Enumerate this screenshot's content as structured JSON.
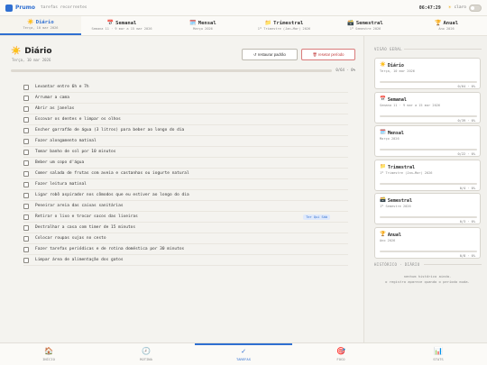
{
  "app": {
    "name": "Prumo",
    "subtitle": "tarefas recorrentes",
    "clock": "06:47:29",
    "theme_label": "claro"
  },
  "tabs": [
    {
      "icon": "☀️",
      "title": "Diário",
      "sub": "Terça, 10 mar 2026",
      "active": true
    },
    {
      "icon": "📅",
      "title": "Semanal",
      "sub": "Semana 11 · 9 mar a 15 mar 2026",
      "active": false
    },
    {
      "icon": "🗓️",
      "title": "Mensal",
      "sub": "Março 2026",
      "active": false
    },
    {
      "icon": "📁",
      "title": "Trimestral",
      "sub": "1º Trimestre (Jan–Mar) 2026",
      "active": false
    },
    {
      "icon": "🗃️",
      "title": "Semestral",
      "sub": "1º Semestre 2026",
      "active": false
    },
    {
      "icon": "🏆",
      "title": "Anual",
      "sub": "Ano 2026",
      "active": false
    }
  ],
  "period": {
    "icon": "☀️",
    "title": "Diário",
    "sub": "Terça, 10 mar 2026",
    "progress": 0,
    "progress_label": "0/64 · 0%"
  },
  "buttons": {
    "restore": "↺ restaurar padrão",
    "reset": "🗑 resetar período"
  },
  "tasks": [
    {
      "label": "Levantar entre 6h e 7h"
    },
    {
      "label": "Arrumar a cama"
    },
    {
      "label": "Abrir as janelas"
    },
    {
      "label": "Escovar os dentes e limpar os olhos"
    },
    {
      "label": "Encher garrafão de água (3 litros) para beber ao longo do dia"
    },
    {
      "label": "Fazer alongamento matinal"
    },
    {
      "label": "Tomar banho de sol por 10 minutos"
    },
    {
      "label": "Beber um copo d'água"
    },
    {
      "label": "Comer salada de frutas com aveia e castanhas ou iogurte natural"
    },
    {
      "label": "Fazer leitura matinal"
    },
    {
      "label": "Ligar robô aspirador nos cômodos que eu estiver ao longo do dia"
    },
    {
      "label": "Peneirar areia das caixas sanitárias"
    },
    {
      "label": "Retirar o lixo e trocar sacos das lixeiras",
      "tag": "Ter Qui Sáb"
    },
    {
      "label": "Destralhar a casa com timer de 15 minutos"
    },
    {
      "label": "Colocar roupas sujas no cesto"
    },
    {
      "label": "Fazer tarefas periódicas e de rotina doméstica por 30 minutos"
    },
    {
      "label": "Limpar área de alimentação dos gatos"
    }
  ],
  "sidebar": {
    "overview_heading": "VISÃO GERAL",
    "cards": [
      {
        "icon": "☀️",
        "title": "Diário",
        "sub": "Terça, 10 mar 2026",
        "count": "0/64 · 0%",
        "progress": 0
      },
      {
        "icon": "📅",
        "title": "Semanal",
        "sub": "Semana 11 · 9 mar a 15 mar 2026",
        "count": "0/39 · 0%",
        "progress": 0
      },
      {
        "icon": "🗓️",
        "title": "Mensal",
        "sub": "Março 2026",
        "count": "0/22 · 0%",
        "progress": 0
      },
      {
        "icon": "📁",
        "title": "Trimestral",
        "sub": "1º Trimestre (Jan–Mar) 2026",
        "count": "0/4 · 0%",
        "progress": 0
      },
      {
        "icon": "🗃️",
        "title": "Semestral",
        "sub": "1º Semestre 2026",
        "count": "0/3 · 0%",
        "progress": 0
      },
      {
        "icon": "🏆",
        "title": "Anual",
        "sub": "Ano 2026",
        "count": "0/8 · 0%",
        "progress": 0
      }
    ],
    "history_heading": "HISTÓRICO · DIÁRIO",
    "history_empty_1": "nenhum histórico ainda.",
    "history_empty_2": "o registro aparece quando o período muda."
  },
  "bottom_nav": [
    {
      "icon": "🏠",
      "label": "INÍCIO",
      "active": false
    },
    {
      "icon": "🕗",
      "label": "ROTINA",
      "active": false
    },
    {
      "icon": "✓",
      "label": "TAREFAS",
      "active": true
    },
    {
      "icon": "🎯",
      "label": "FOCO",
      "active": false
    },
    {
      "icon": "📊",
      "label": "STATS",
      "active": false
    }
  ]
}
